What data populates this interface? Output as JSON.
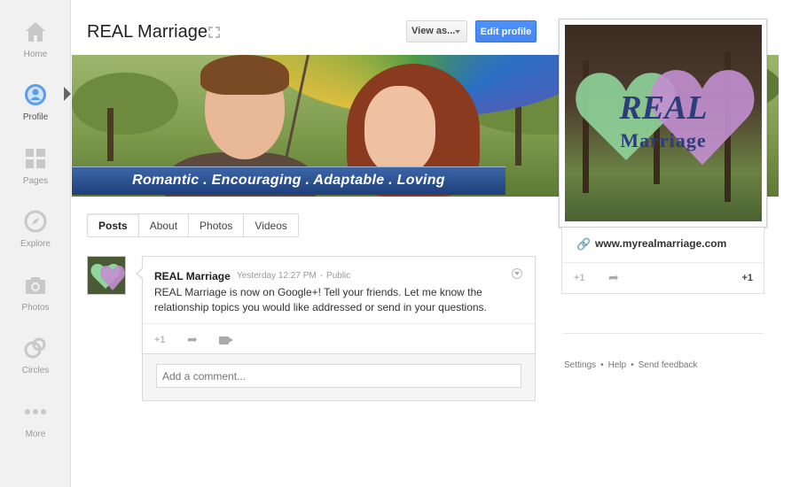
{
  "nav": {
    "items": [
      {
        "label": "Home",
        "icon": "home-icon"
      },
      {
        "label": "Profile",
        "icon": "profile-icon",
        "active": true
      },
      {
        "label": "Pages",
        "icon": "pages-icon"
      },
      {
        "label": "Explore",
        "icon": "compass-icon"
      },
      {
        "label": "Photos",
        "icon": "camera-icon"
      },
      {
        "label": "Circles",
        "icon": "circles-icon"
      },
      {
        "label": "More",
        "icon": "more-dots-icon"
      }
    ]
  },
  "header": {
    "title": "REAL Marriage",
    "view_as_label": "View as...",
    "edit_profile_label": "Edit profile"
  },
  "cover": {
    "tagline": "Romantic . Encouraging . Adaptable . Loving"
  },
  "profile_card": {
    "avatar_text_line1": "REAL",
    "avatar_text_line2": "Marriage",
    "website": "www.myrealmarriage.com",
    "plus_one_label": "+1",
    "plus_one_count": "+1"
  },
  "tabs": [
    {
      "label": "Posts",
      "active": true
    },
    {
      "label": "About"
    },
    {
      "label": "Photos"
    },
    {
      "label": "Videos"
    }
  ],
  "post": {
    "author": "REAL Marriage",
    "time": "Yesterday 12:27 PM",
    "visibility": "Public",
    "body": "REAL Marriage is now on Google+! Tell your friends. Let me know the relationship topics you would like addressed or send in your questions.",
    "plus_one_label": "+1",
    "comment_placeholder": "Add a comment..."
  },
  "footer": {
    "settings": "Settings",
    "help": "Help",
    "feedback": "Send feedback"
  },
  "colors": {
    "accent_blue": "#4d90fe",
    "tagline_blue": "#1e3f7a",
    "nav_bg": "#f1f1f1"
  }
}
